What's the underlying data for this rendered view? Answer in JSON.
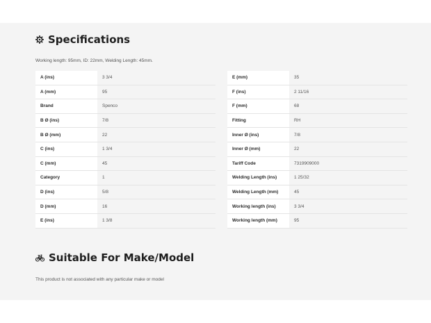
{
  "specifications": {
    "title": "Specifications",
    "icon": "gear-icon",
    "intro": "Working length: 95mm, ID: 22mm, Welding Length: 45mm.",
    "left": [
      {
        "label": "A (ins)",
        "value": "3 3/4"
      },
      {
        "label": "A (mm)",
        "value": "95"
      },
      {
        "label": "Brand",
        "value": "Spenco"
      },
      {
        "label": "B Ø (ins)",
        "value": "7/8"
      },
      {
        "label": "B Ø (mm)",
        "value": "22"
      },
      {
        "label": "C (ins)",
        "value": "1 3/4"
      },
      {
        "label": "C (mm)",
        "value": "45"
      },
      {
        "label": "Category",
        "value": "1"
      },
      {
        "label": "D (ins)",
        "value": "5/8"
      },
      {
        "label": "D (mm)",
        "value": "16"
      },
      {
        "label": "E (ins)",
        "value": "1 3/8"
      }
    ],
    "right": [
      {
        "label": "E (mm)",
        "value": "35"
      },
      {
        "label": "F (ins)",
        "value": "2 11/16"
      },
      {
        "label": "F (mm)",
        "value": "68"
      },
      {
        "label": "Fitting",
        "value": "RH"
      },
      {
        "label": "Inner Ø (ins)",
        "value": "7/8"
      },
      {
        "label": "Inner Ø (mm)",
        "value": "22"
      },
      {
        "label": "Tariff Code",
        "value": "7319909000"
      },
      {
        "label": "Welding Length (ins)",
        "value": "1 25/32"
      },
      {
        "label": "Welding Length (mm)",
        "value": "45"
      },
      {
        "label": "Working length (ins)",
        "value": "3 3/4"
      },
      {
        "label": "Working length (mm)",
        "value": "95"
      }
    ]
  },
  "suitable": {
    "title": "Suitable For Make/Model",
    "icon": "bicycle-icon",
    "note": "This product is not associated with any particular make or model"
  }
}
